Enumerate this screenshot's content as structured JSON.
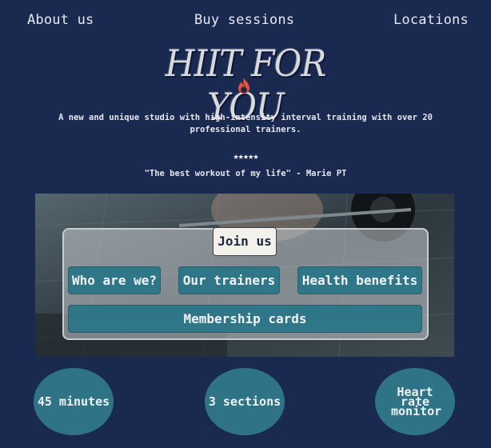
{
  "nav": {
    "about": "About us",
    "buy": "Buy sessions",
    "locations": "Locations"
  },
  "logo": {
    "text": "HIIT FOR YOU",
    "icon": "flame-icon"
  },
  "tagline": "A new and unique studio with high-intensity interval training with over 20 professional trainers.",
  "rating": {
    "stars_text": "★★★★★",
    "value": 5,
    "max": 5
  },
  "quote": "\"The best workout of my life\" - Marie PT",
  "hero": {
    "join": "Join us",
    "buttons": {
      "who": "Who are we?",
      "trainers": "Our trainers",
      "health": "Health benefits",
      "membership": "Membership cards"
    }
  },
  "features": {
    "duration": "45 minutes",
    "sections": "3 sections",
    "heart": "Heart rate monitor"
  },
  "colors": {
    "background": "#19294f",
    "accent": "#2f7688",
    "join_bg": "#f2f1ea",
    "flame": "#e0523a"
  }
}
